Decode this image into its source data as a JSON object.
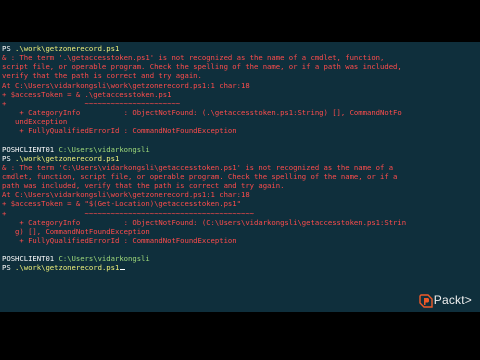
{
  "console": {
    "lines": [
      {
        "s": [
          {
            "c": "w",
            "t": "PS "
          },
          {
            "c": "y",
            "t": ".\\work\\getzonerecord.ps1"
          }
        ]
      },
      {
        "s": [
          {
            "c": "r",
            "t": "& : The term '.\\getaccesstoken.ps1' is not recognized as the name of a cmdlet, function,"
          }
        ]
      },
      {
        "s": [
          {
            "c": "r",
            "t": "script file, or operable program. Check the spelling of the name, or if a path was included,"
          }
        ]
      },
      {
        "s": [
          {
            "c": "r",
            "t": "verify that the path is correct and try again."
          }
        ]
      },
      {
        "s": [
          {
            "c": "r",
            "t": "At C:\\Users\\vidarkongsli\\work\\getzonerecord.ps1:1 char:18"
          }
        ]
      },
      {
        "s": [
          {
            "c": "r",
            "t": "+ $accessToken = & .\\getaccesstoken.ps1"
          }
        ]
      },
      {
        "s": [
          {
            "c": "r",
            "t": "+                  ~~~~~~~~~~~~~~~~~~~~~~"
          }
        ]
      },
      {
        "s": [
          {
            "c": "r",
            "t": "    + CategoryInfo          : ObjectNotFound: (.\\getaccesstoken.ps1:String) [], CommandNotFo"
          }
        ]
      },
      {
        "s": [
          {
            "c": "r",
            "t": "   undException"
          }
        ]
      },
      {
        "s": [
          {
            "c": "r",
            "t": "    + FullyQualifiedErrorId : CommandNotFoundException"
          }
        ]
      },
      {
        "s": [
          {
            "c": "w",
            "t": ""
          }
        ]
      },
      {
        "s": [
          {
            "c": "w",
            "t": "POSHCLIENT01 "
          },
          {
            "c": "g",
            "t": "C:\\Users\\vidarkongsli"
          }
        ]
      },
      {
        "s": [
          {
            "c": "w",
            "t": "PS "
          },
          {
            "c": "y",
            "t": ".\\work\\getzonerecord.ps1"
          }
        ]
      },
      {
        "s": [
          {
            "c": "r",
            "t": "& : The term 'C:\\Users\\vidarkongsli\\getaccesstoken.ps1' is not recognized as the name of a"
          }
        ]
      },
      {
        "s": [
          {
            "c": "r",
            "t": "cmdlet, function, script file, or operable program. Check the spelling of the name, or if a"
          }
        ]
      },
      {
        "s": [
          {
            "c": "r",
            "t": "path was included, verify that the path is correct and try again."
          }
        ]
      },
      {
        "s": [
          {
            "c": "r",
            "t": "At C:\\Users\\vidarkongsli\\work\\getzonerecord.ps1:1 char:18"
          }
        ]
      },
      {
        "s": [
          {
            "c": "r",
            "t": "+ $accessToken = & \"$(Get-Location)\\getaccesstoken.ps1\""
          }
        ]
      },
      {
        "s": [
          {
            "c": "r",
            "t": "+                  ~~~~~~~~~~~~~~~~~~~~~~~~~~~~~~~~~~~~~~~"
          }
        ]
      },
      {
        "s": [
          {
            "c": "r",
            "t": "    + CategoryInfo          : ObjectNotFound: (C:\\Users\\vidarkongsli\\getaccesstoken.ps1:Strin"
          }
        ]
      },
      {
        "s": [
          {
            "c": "r",
            "t": "   g) [], CommandNotFoundException"
          }
        ]
      },
      {
        "s": [
          {
            "c": "r",
            "t": "    + FullyQualifiedErrorId : CommandNotFoundException"
          }
        ]
      },
      {
        "s": [
          {
            "c": "w",
            "t": ""
          }
        ]
      },
      {
        "s": [
          {
            "c": "w",
            "t": "POSHCLIENT01 "
          },
          {
            "c": "g",
            "t": "C:\\Users\\vidarkongsli"
          }
        ]
      },
      {
        "s": [
          {
            "c": "w",
            "t": "PS "
          },
          {
            "c": "y",
            "t": ".\\work\\getzonerecord.ps1"
          }
        ],
        "cursor": true
      }
    ]
  },
  "brand": {
    "name": "Packt>",
    "icon": "packt-logo-icon",
    "color": "#f05a28"
  },
  "colors": {
    "console_bg": "#0f2f3c",
    "error": "#ff4c4c",
    "path": "#9fd97a",
    "command": "#f2f27a",
    "text": "#ffffff"
  }
}
